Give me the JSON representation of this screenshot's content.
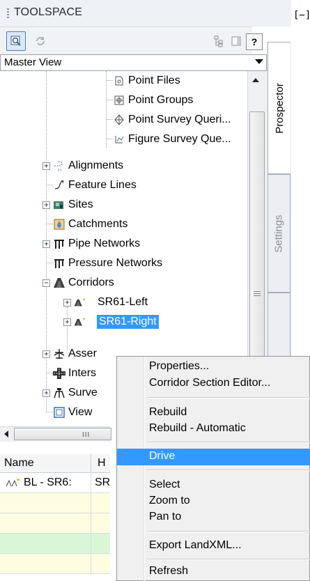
{
  "window": {
    "title": "TOOLSPACE",
    "corner_text": "[−]"
  },
  "toolbar": {
    "inspect_icon": "magnifier-icon",
    "refresh_icon": "refresh-icon",
    "tree_icon": "tree-view-icon",
    "panel_icon": "panel-icon",
    "help_label": "?"
  },
  "view_select": {
    "value": "Master View"
  },
  "side_tabs": [
    {
      "label": "Prospector"
    },
    {
      "label": "Settings"
    },
    {
      "label": ""
    }
  ],
  "tree": {
    "items": [
      {
        "label": "Point Files",
        "icon": "point-files-icon"
      },
      {
        "label": "Point Groups",
        "icon": "point-groups-icon"
      },
      {
        "label": "Point Survey Queri...",
        "icon": "survey-query-icon"
      },
      {
        "label": "Figure Survey Que...",
        "icon": "figure-query-icon"
      },
      {
        "label": "Alignments",
        "icon": "alignment-icon"
      },
      {
        "label": "Feature Lines",
        "icon": "feature-line-icon"
      },
      {
        "label": "Sites",
        "icon": "sites-icon"
      },
      {
        "label": "Catchments",
        "icon": "catchment-icon"
      },
      {
        "label": "Pipe Networks",
        "icon": "pipe-network-icon"
      },
      {
        "label": "Pressure Networks",
        "icon": "pressure-network-icon"
      },
      {
        "label": "Corridors",
        "icon": "corridor-icon"
      },
      {
        "label": "SR61-Left",
        "icon": "corridor-item-icon"
      },
      {
        "label": "SR61-Right",
        "icon": "corridor-item-icon"
      },
      {
        "label": "Asser",
        "icon": "assembly-icon"
      },
      {
        "label": "Inters",
        "icon": "intersection-icon"
      },
      {
        "label": "Surve",
        "icon": "survey-icon"
      },
      {
        "label": "View",
        "icon": "view-frame-icon"
      }
    ]
  },
  "grid": {
    "columns": [
      "Name",
      "H"
    ],
    "rows": [
      {
        "name": "BL - SR6:",
        "h": "SR"
      }
    ]
  },
  "context_menu": {
    "items": [
      "Properties...",
      "Corridor Section Editor...",
      "Rebuild",
      "Rebuild - Automatic",
      "Drive",
      "Select",
      "Zoom to",
      "Pan to",
      "Export LandXML...",
      "Refresh"
    ],
    "highlighted": "Drive"
  },
  "colors": {
    "selection": "#3399ff",
    "row_yellow": "#fffde1",
    "row_green": "#d9f7d6"
  }
}
